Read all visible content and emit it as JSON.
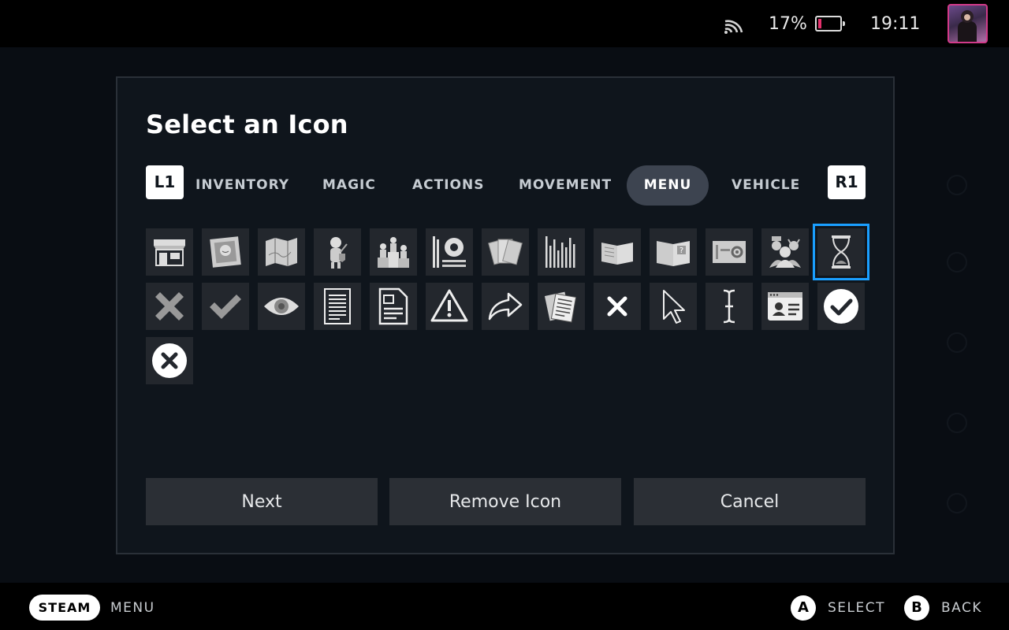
{
  "status": {
    "battery_pct_text": "17%",
    "battery_level": 0.17,
    "clock": "19:11"
  },
  "modal": {
    "title": "Select an Icon",
    "left_shoulder": "L1",
    "right_shoulder": "R1",
    "tabs": [
      {
        "label": "INVENTORY",
        "active": false
      },
      {
        "label": "MAGIC",
        "active": false
      },
      {
        "label": "ACTIONS",
        "active": false
      },
      {
        "label": "MOVEMENT",
        "active": false
      },
      {
        "label": "MENU",
        "active": true
      },
      {
        "label": "VEHICLE",
        "active": false
      }
    ],
    "icons": [
      "shop-icon",
      "portrait-frame-icon",
      "map-icon",
      "knight-icon",
      "podium-icon",
      "stats-icon",
      "cards-icon",
      "bars-icon",
      "book-icon",
      "help-book-icon",
      "settings-panel-icon",
      "party-icon",
      "hourglass-icon",
      "x-mark-icon",
      "check-icon",
      "eye-icon",
      "document-icon",
      "page-icon",
      "warning-icon",
      "share-arrow-icon",
      "papers-icon",
      "close-icon",
      "cursor-icon",
      "text-cursor-icon",
      "id-card-icon",
      "check-circle-icon",
      "x-circle-icon"
    ],
    "selected_icon": "hourglass-icon",
    "buttons": {
      "next": "Next",
      "remove": "Remove Icon",
      "cancel": "Cancel"
    }
  },
  "footer": {
    "steam": "STEAM",
    "menu": "MENU",
    "a_glyph": "A",
    "select": "SELECT",
    "b_glyph": "B",
    "back": "BACK"
  },
  "colors": {
    "accent": "#1a9fff",
    "battery_low": "#e5316d",
    "tile_bg": "#23272d"
  }
}
